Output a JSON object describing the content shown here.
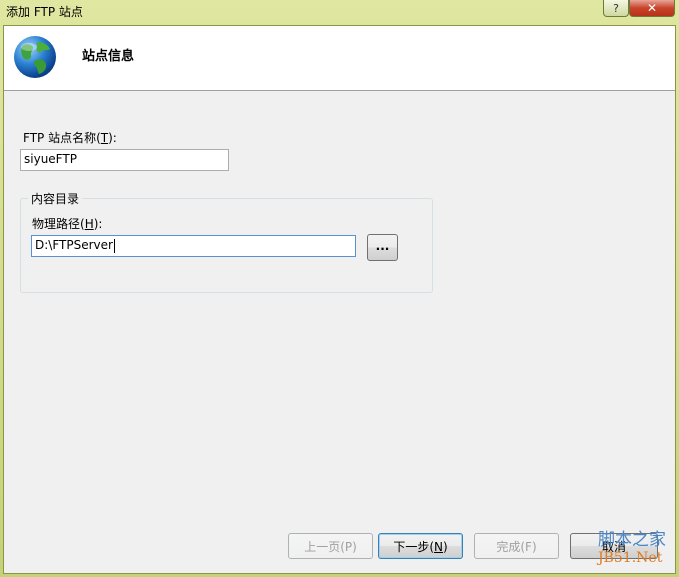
{
  "window": {
    "title": "添加 FTP 站点",
    "help_label": "?",
    "close_label": "✕"
  },
  "header": {
    "icon": "globe-icon",
    "title": "站点信息"
  },
  "form": {
    "site_name_label": "FTP 站点名称(",
    "site_name_key": "T",
    "site_name_label_end": "):",
    "site_name_value": "siyueFTP",
    "content_group_label": "内容目录",
    "path_label": "物理路径(",
    "path_key": "H",
    "path_label_end": "):",
    "path_value": "D:\\FTPServer",
    "browse_label": "..."
  },
  "buttons": {
    "prev": "上一页(P)",
    "next": "下一步(",
    "next_key": "N",
    "next_end": ")",
    "finish": "完成(F)",
    "cancel": "取消"
  },
  "watermark": {
    "line1": "脚本之家",
    "line2": "JB51.Net"
  },
  "colors": {
    "titlebar": "#d3dd8c",
    "close_button": "#c8442b",
    "focus_border": "#5b8fd6",
    "watermark_blue": "#4a86c5",
    "watermark_orange": "#e07b1e"
  }
}
